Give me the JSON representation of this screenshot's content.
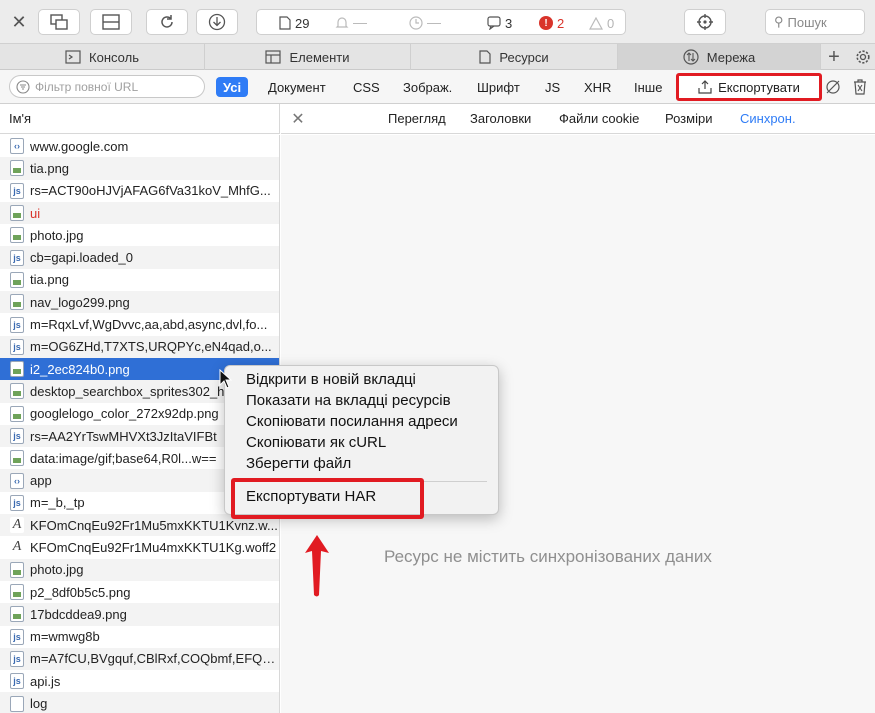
{
  "toolbar": {
    "status": {
      "documents_count": "29",
      "errors_count": "2",
      "messages_count": "3",
      "warnings_count": "0"
    },
    "search_placeholder": "Пошук"
  },
  "tabs": [
    {
      "label": "Консоль"
    },
    {
      "label": "Елементи"
    },
    {
      "label": "Ресурси"
    },
    {
      "label": "Мережа",
      "active": true
    }
  ],
  "filterbar": {
    "url_filter_placeholder": "Фільтр повної URL",
    "types": [
      "Усі",
      "Документ",
      "CSS",
      "Зображ.",
      "Шрифт",
      "JS",
      "XHR",
      "Інше"
    ],
    "active_type": "Усі",
    "export_label": "Експортувати"
  },
  "list": {
    "header": "Ім'я",
    "rows": [
      {
        "label": "www.google.com",
        "icon": "document-icon"
      },
      {
        "label": "tia.png",
        "icon": "image-icon"
      },
      {
        "label": "rs=ACT90oHJVjAFAG6fVa31koV_MhfG...",
        "icon": "script-icon"
      },
      {
        "label": "ui",
        "icon": "image-icon",
        "red": true
      },
      {
        "label": "photo.jpg",
        "icon": "image-icon"
      },
      {
        "label": "cb=gapi.loaded_0",
        "icon": "script-icon"
      },
      {
        "label": "tia.png",
        "icon": "image-icon"
      },
      {
        "label": "nav_logo299.png",
        "icon": "image-icon"
      },
      {
        "label": "m=RqxLvf,WgDvvc,aa,abd,async,dvl,fo...",
        "icon": "script-icon"
      },
      {
        "label": "m=OG6ZHd,T7XTS,URQPYc,eN4qad,o...",
        "icon": "script-icon"
      },
      {
        "label": "i2_2ec824b0.png",
        "icon": "image-icon",
        "selected": true
      },
      {
        "label": "desktop_searchbox_sprites302_h",
        "icon": "image-icon"
      },
      {
        "label": "googlelogo_color_272x92dp.png",
        "icon": "image-icon"
      },
      {
        "label": "rs=AA2YrTswMHVXt3JzItaVIFBt",
        "icon": "script-icon"
      },
      {
        "label": "data:image/gif;base64,R0l...w==",
        "icon": "image-icon"
      },
      {
        "label": "app",
        "icon": "document-icon"
      },
      {
        "label": "m=_b,_tp",
        "icon": "script-icon"
      },
      {
        "label": "KFOmCnqEu92Fr1Mu5mxKKTU1Kvnz.w...",
        "icon": "font-icon"
      },
      {
        "label": "KFOmCnqEu92Fr1Mu4mxKKTU1Kg.woff2",
        "icon": "font-icon"
      },
      {
        "label": "photo.jpg",
        "icon": "image-icon"
      },
      {
        "label": "p2_8df0b5c5.png",
        "icon": "image-icon"
      },
      {
        "label": "17bdcddea9.png",
        "icon": "image-icon"
      },
      {
        "label": "m=wmwg8b",
        "icon": "script-icon"
      },
      {
        "label": "m=A7fCU,BVgquf,CBlRxf,COQbmf,EFQ7...",
        "icon": "script-icon"
      },
      {
        "label": "api.js",
        "icon": "script-icon"
      },
      {
        "label": "log",
        "icon": "blank-file-icon"
      }
    ]
  },
  "detail": {
    "tabs": [
      "Перегляд",
      "Заголовки",
      "Файли cookie",
      "Розміри",
      "Синхрон."
    ],
    "active_tab": "Синхрон.",
    "empty_message": "Ресурс не містить синхронізованих даних"
  },
  "context_menu": {
    "items": [
      "Відкрити в новій вкладці",
      "Показати на вкладці ресурсів",
      "Скопіювати посилання адреси",
      "Скопіювати як cURL",
      "Зберегти файл"
    ],
    "export_har": "Експортувати HAR"
  },
  "colors": {
    "accent": "#2f7cf6",
    "selection": "#2f6fd6",
    "annotation_red": "#e11b22",
    "error": "#d9342b"
  }
}
